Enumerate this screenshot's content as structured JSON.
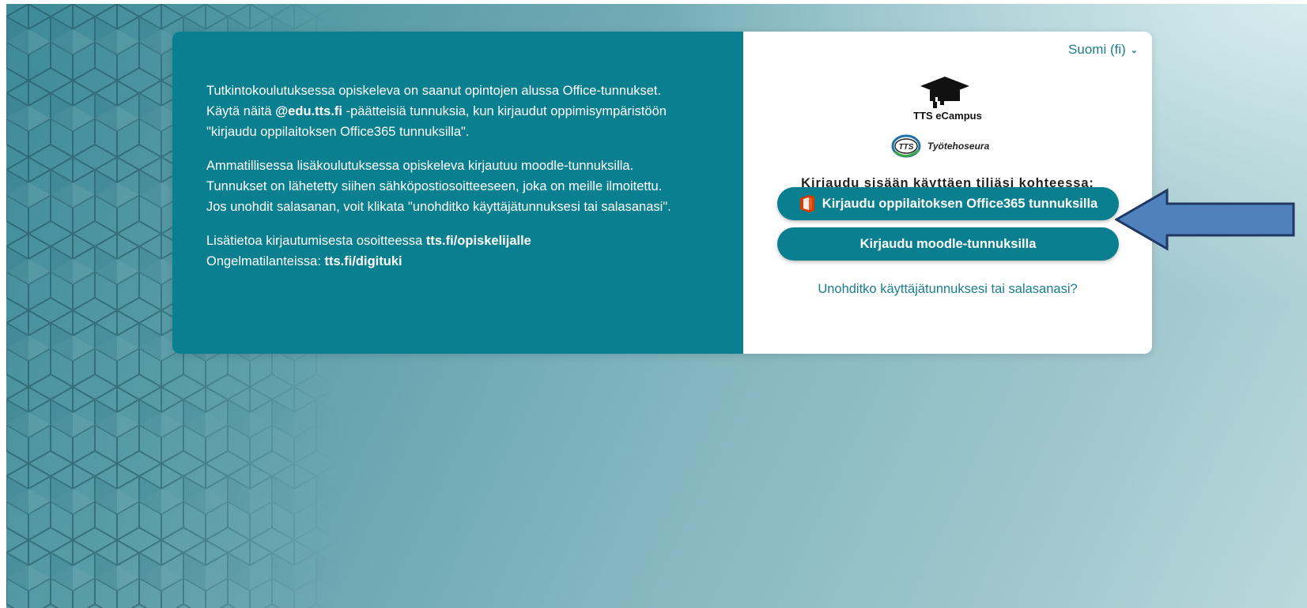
{
  "info": {
    "p1_line1": "Tutkintokoulutuksessa opiskeleva on saanut opintojen alussa Office-tunnukset.",
    "p1_line2_pre": "Käytä näitä ",
    "p1_line2_bold": "@edu.tts.fi",
    "p1_line2_post": " -päätteisiä tunnuksia, kun kirjaudut oppimisympäristöön",
    "p1_line3": "\"kirjaudu oppilaitoksen Office365 tunnuksilla\".",
    "p2_line1": "Ammatillisessa lisäkoulutuksessa opiskeleva kirjautuu moodle-tunnuksilla.",
    "p2_line2": "Tunnukset on lähetetty siihen sähköpostiosoitteeseen, joka on meille ilmoitettu.",
    "p2_line3": "Jos unohdit salasanan, voit klikata \"unohditko käyttäjätunnuksesi tai salasanasi\".",
    "p3_line1_pre": "Lisätietoa kirjautumisesta osoitteessa ",
    "p3_line1_link": "tts.fi/opiskelijalle",
    "p3_line2_pre": "Ongelmatilanteissa: ",
    "p3_line2_link": "tts.fi/digituki"
  },
  "login": {
    "language": "Suomi (fi)",
    "logo_campus_text": "TTS eCampus",
    "logo_org_text": "Työtehoseura",
    "logo_org_badge": "TTS",
    "heading": "Kirjaudu sisään käyttäen tiliäsi kohteessa:",
    "office_button": "Kirjaudu oppilaitoksen Office365 tunnuksilla",
    "moodle_button": "Kirjaudu moodle-tunnuksilla",
    "forgot_link": "Unohditko käyttäjätunnuksesi tai salasanasi?"
  },
  "icons": {
    "language": "chevron-down-icon",
    "campus_logo": "graduation-cap-icon",
    "org_logo": "tts-logo-icon",
    "office": "office365-icon",
    "annotation": "arrow-left-icon"
  },
  "colors": {
    "teal": "#0a7f8f",
    "link": "#1b7d8c",
    "office_orange": "#d83b01",
    "arrow_fill": "#4f81bd",
    "arrow_stroke": "#1f3864"
  }
}
